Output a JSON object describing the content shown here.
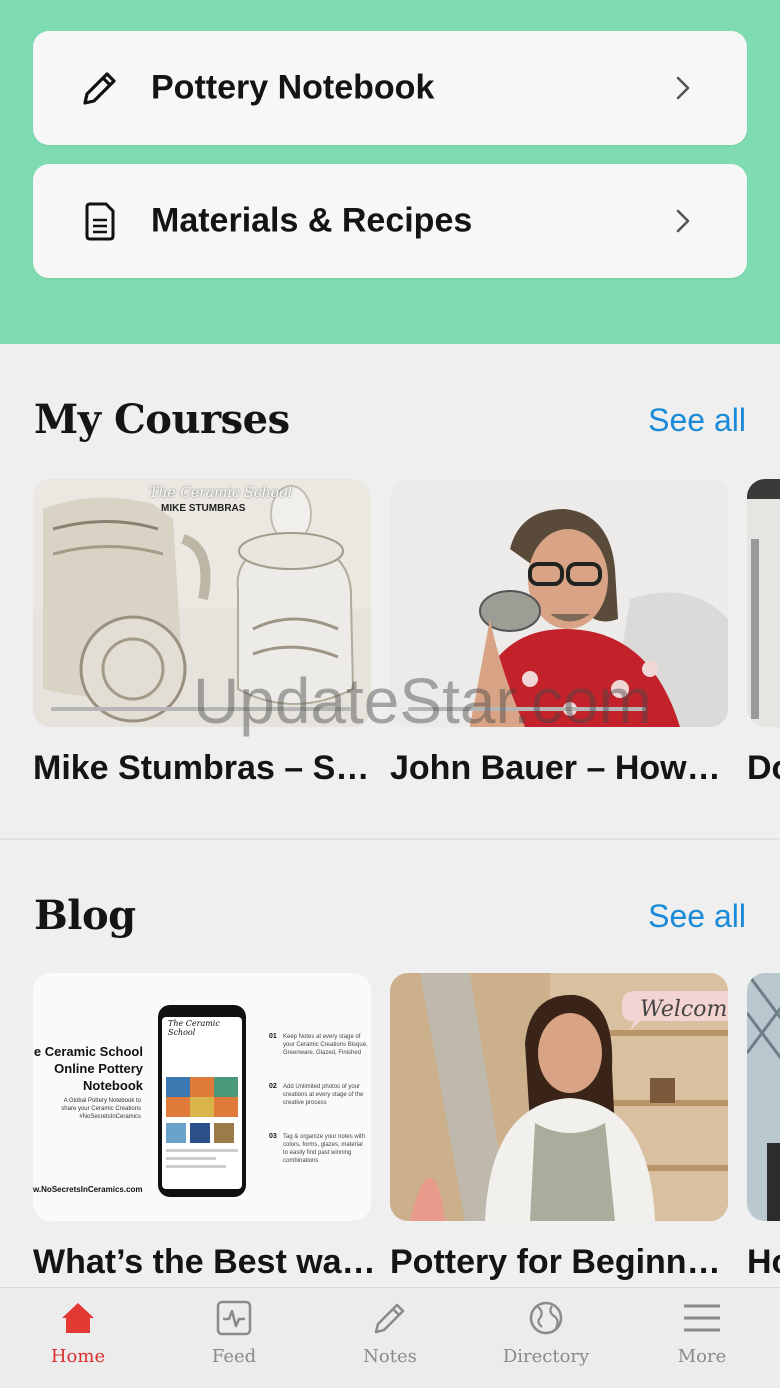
{
  "menu": [
    {
      "label": "Pottery Notebook",
      "icon": "pencil-icon"
    },
    {
      "label": "Materials & Recipes",
      "icon": "document-icon"
    }
  ],
  "courses": {
    "title": "My Courses",
    "see_all": "See all",
    "items": [
      {
        "title": "Mike Stumbras – S…",
        "overlay_brand": "The Ceramic School",
        "overlay_name": "MIKE STUMBRAS"
      },
      {
        "title": "John Bauer – How…"
      },
      {
        "title": "Do"
      }
    ]
  },
  "blog": {
    "title": "Blog",
    "see_all": "See all",
    "items": [
      {
        "title": "What’s the Best wa…",
        "promo_heading": [
          "e Ceramic School",
          "Online Pottery",
          "Notebook"
        ],
        "promo_sub": "A Global Pottery Notebook to share your Ceramic Creations #NoSecretsInCeramics",
        "promo_url": "w.NoSecretsInCeramics.com",
        "phone_brand": "The Ceramic School",
        "steps": [
          {
            "num": "01",
            "text": "Keep Notes at every stage of your Ceramic Creations Bisque, Greenware, Glazed, Finished"
          },
          {
            "num": "02",
            "text": "Add Unlimited photos of your creations at every stage of the creative process"
          },
          {
            "num": "03",
            "text": "Tag & organize your notes with colors, forms, glazes, material to easily find past winning combinations"
          }
        ]
      },
      {
        "title": "Pottery for Beginn…",
        "overlay": "Welcom"
      },
      {
        "title": "Ho"
      }
    ]
  },
  "watermark": "UpdateStar.com",
  "nav": [
    {
      "label": "Home",
      "icon": "home-icon",
      "active": true
    },
    {
      "label": "Feed",
      "icon": "activity-icon",
      "active": false
    },
    {
      "label": "Notes",
      "icon": "pencil-icon",
      "active": false
    },
    {
      "label": "Directory",
      "icon": "globe-icon",
      "active": false
    },
    {
      "label": "More",
      "icon": "menu-icon",
      "active": false
    }
  ],
  "colors": {
    "accent": "#7fdbb1",
    "link": "#1a8ad8",
    "active_nav": "#d92f2f"
  }
}
